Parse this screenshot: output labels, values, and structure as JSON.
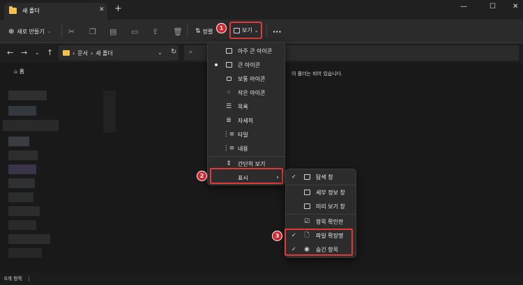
{
  "window": {
    "tab_title": "새 폴더",
    "close_tab": "✕",
    "add_tab": "+",
    "minimize": "—",
    "maximize": "☐",
    "close": "✕"
  },
  "toolbar": {
    "new_label": "새로 만들기",
    "sort_label": "정렬",
    "view_label": "보기",
    "more_label": "···"
  },
  "address": {
    "breadcrumb_1": "문서",
    "breadcrumb_2": "새 폴더"
  },
  "sidebar": {
    "home_label": "홈"
  },
  "content": {
    "empty_message": "이 폴더는 비어 있습니다."
  },
  "status": {
    "item_count": "0개 항목"
  },
  "view_menu": {
    "items": [
      {
        "label": "아주 큰 아이콘",
        "icon": "monitor-icon"
      },
      {
        "label": "큰 아이콘",
        "icon": "monitor-icon",
        "selected": true
      },
      {
        "label": "보통 아이콘",
        "icon": "monitor-small-icon"
      },
      {
        "label": "작은 아이콘",
        "icon": "small-grid-icon"
      },
      {
        "label": "목록",
        "icon": "list-icon"
      },
      {
        "label": "자세히",
        "icon": "details-icon"
      },
      {
        "label": "타일",
        "icon": "tiles-icon"
      },
      {
        "label": "내용",
        "icon": "content-icon"
      },
      {
        "label": "간단히 보기",
        "icon": "compact-icon"
      },
      {
        "label": "표시",
        "icon": "",
        "has_submenu": true
      }
    ]
  },
  "show_submenu": {
    "items": [
      {
        "label": "탐색 창",
        "checked": true
      },
      {
        "label": "세부 정보 창",
        "checked": false
      },
      {
        "label": "미리 보기 창",
        "checked": false
      },
      {
        "label": "항목 확인란",
        "checked": false
      },
      {
        "label": "파일 확장명",
        "checked": true
      },
      {
        "label": "숨긴 항목",
        "checked": true
      }
    ]
  },
  "markers": [
    "1",
    "2",
    "3"
  ],
  "colors": {
    "highlight": "#e03a3a",
    "marker": "#d7262b",
    "folder": "#f3c14f"
  }
}
